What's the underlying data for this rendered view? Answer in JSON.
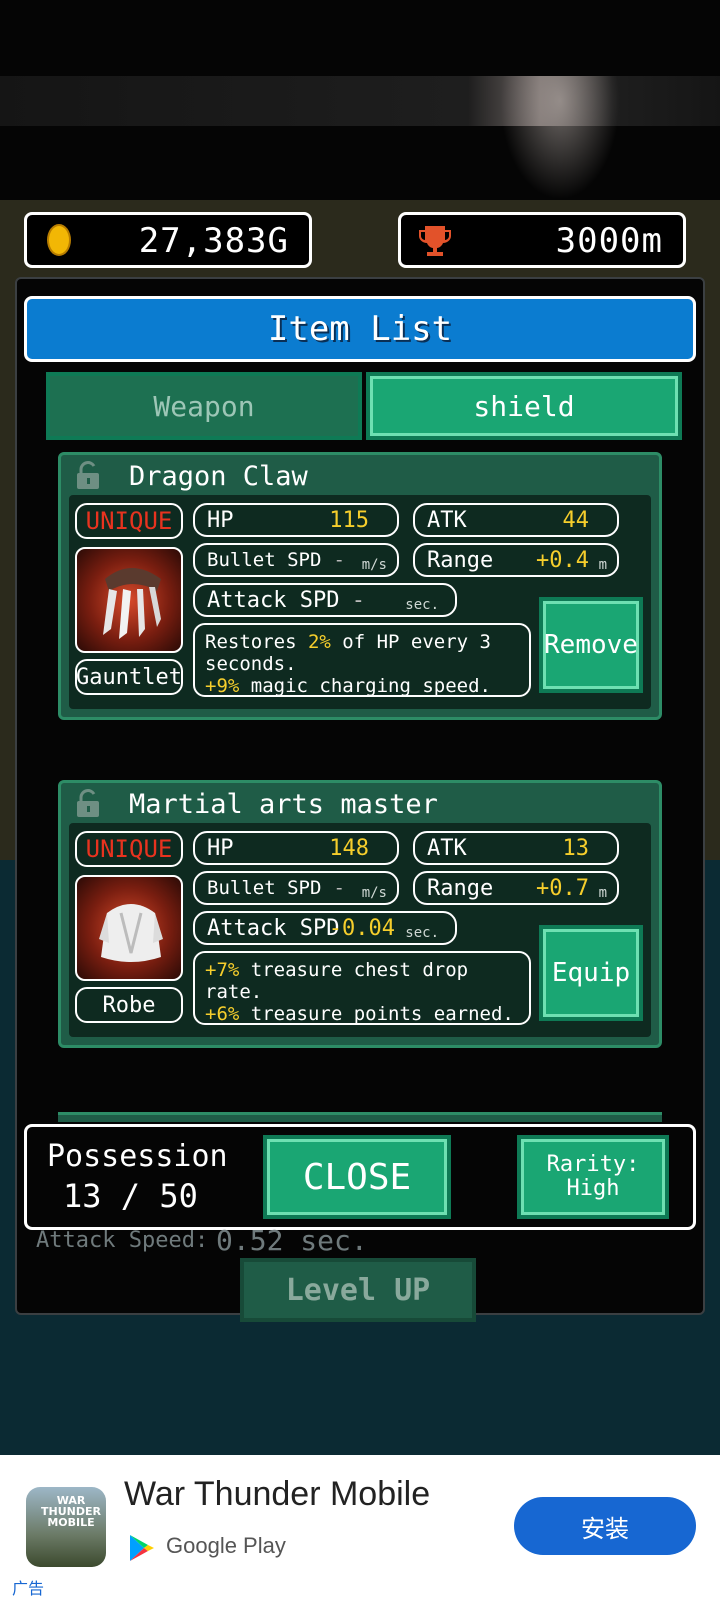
{
  "header": {
    "gold": "27,383G",
    "distance": "3000m"
  },
  "panel": {
    "title": "Item List",
    "tabs": [
      {
        "label": "Weapon",
        "active": false
      },
      {
        "label": "shield",
        "active": true
      }
    ]
  },
  "items": [
    {
      "name": "Dragon Claw",
      "rarity": "UNIQUE",
      "type": "Gauntlet",
      "hp_label": "HP",
      "hp": "115",
      "atk_label": "ATK",
      "atk": "44",
      "bullet_spd_label": "Bullet SPD",
      "bullet_spd": "-",
      "bullet_spd_unit": "m/s",
      "range_label": "Range",
      "range": "+0.4",
      "range_unit": "m",
      "attack_spd_label": "Attack SPD",
      "attack_spd": "-",
      "attack_spd_unit": "sec.",
      "desc_pre": "Restores ",
      "desc_hl1": "2%",
      "desc_mid": " of HP every 3 seconds.",
      "desc_hl2": "+9%",
      "desc_post": " magic charging speed.",
      "action": "Remove"
    },
    {
      "name": "Martial arts master",
      "rarity": "UNIQUE",
      "type": "Robe",
      "hp_label": "HP",
      "hp": "148",
      "atk_label": "ATK",
      "atk": "13",
      "bullet_spd_label": "Bullet SPD",
      "bullet_spd": "-",
      "bullet_spd_unit": "m/s",
      "range_label": "Range",
      "range": "+0.7",
      "range_unit": "m",
      "attack_spd_label": "Attack SPD",
      "attack_spd": "-0.04",
      "attack_spd_unit": "sec.",
      "desc_hl1": "+7%",
      "desc_mid": " treasure chest drop rate.",
      "desc_hl2": "+6%",
      "desc_post": " treasure points earned.",
      "action": "Equip"
    }
  ],
  "footer": {
    "possession_label": "Possession",
    "possession_value": "13 / 50",
    "close_label": "CLOSE",
    "rarity_label": "Rarity:\nHigh"
  },
  "behind": {
    "attack_speed_label": "Attack Speed:",
    "attack_speed_value": "0.52 sec.",
    "level_up_label": "Level UP"
  },
  "ad": {
    "app_name": "War Thunder Mobile",
    "store": "Google Play",
    "install_label": "安装",
    "ad_tag": "广告",
    "icon_text": "WAR THUNDER MOBILE"
  },
  "colors": {
    "accent_blue": "#0b7cd0",
    "button_green": "#1aa673",
    "rarity_red": "#e8331f",
    "highlight_yellow": "#f6ce2c",
    "install_blue": "#1767d2"
  }
}
